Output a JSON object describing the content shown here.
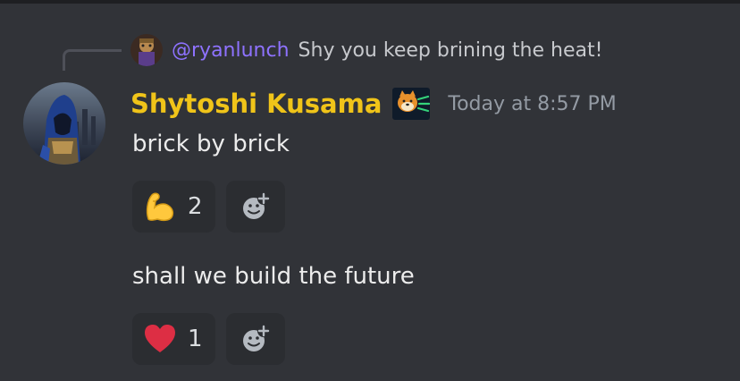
{
  "reply": {
    "username": "@ryanlunch",
    "text": "Shy you keep brining the heat!"
  },
  "author": {
    "name": "Shytoshi Kusama",
    "timestamp": "Today at 8:57 PM",
    "name_color": "#f0c419"
  },
  "messages": [
    {
      "text": "brick by brick",
      "reactions": [
        {
          "emoji": "flexed-biceps-icon",
          "count": "2"
        }
      ]
    },
    {
      "text": "shall we build the future",
      "reactions": [
        {
          "emoji": "red-heart-icon",
          "count": "1"
        }
      ]
    }
  ],
  "colors": {
    "background": "#313338",
    "reaction_bg": "#2b2d31",
    "reply_user": "#8e72ff",
    "timestamp": "#949ba4"
  }
}
